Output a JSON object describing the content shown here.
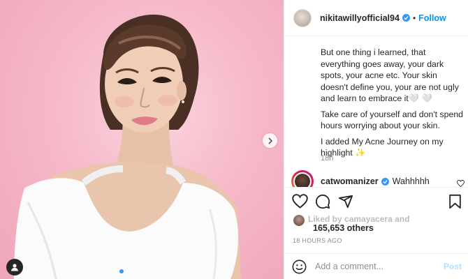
{
  "post": {
    "author": "nikitawillyofficial94",
    "separator": "•",
    "follow_label": "Follow",
    "caption_paragraphs": [
      "But one thing i learned, that everything goes away, your dark spots, your acne etc. Your skin doesn't define you, your are not ugly and learn to embrace it",
      "Take care of yourself and don't spend hours worrying about your skin.",
      "I added My Acne Journey on my highlight"
    ],
    "caption_heart_1": "🤍",
    "caption_heart_2": "🤍",
    "caption_sparkle": "✨",
    "caption_time": "18h",
    "timestamp": "18 HOURS AGO"
  },
  "comment": {
    "user": "catwomanizer",
    "text": "Wahhhhh"
  },
  "likes": {
    "faded_text": "Liked by camayacera and",
    "count": "165,653 others"
  },
  "add_comment": {
    "placeholder": "Add a comment...",
    "post_label": "Post"
  },
  "carousel": {
    "slide_count": 7,
    "active_index": 0
  },
  "colors": {
    "accent": "#0095f6",
    "background_pink": "#f6b9c9",
    "verified": "#3897f0"
  },
  "icons": [
    "chevron-right-icon",
    "user-tag-icon",
    "verified-icon",
    "heart-icon",
    "comment-icon",
    "share-icon",
    "bookmark-icon",
    "emoji-icon"
  ]
}
